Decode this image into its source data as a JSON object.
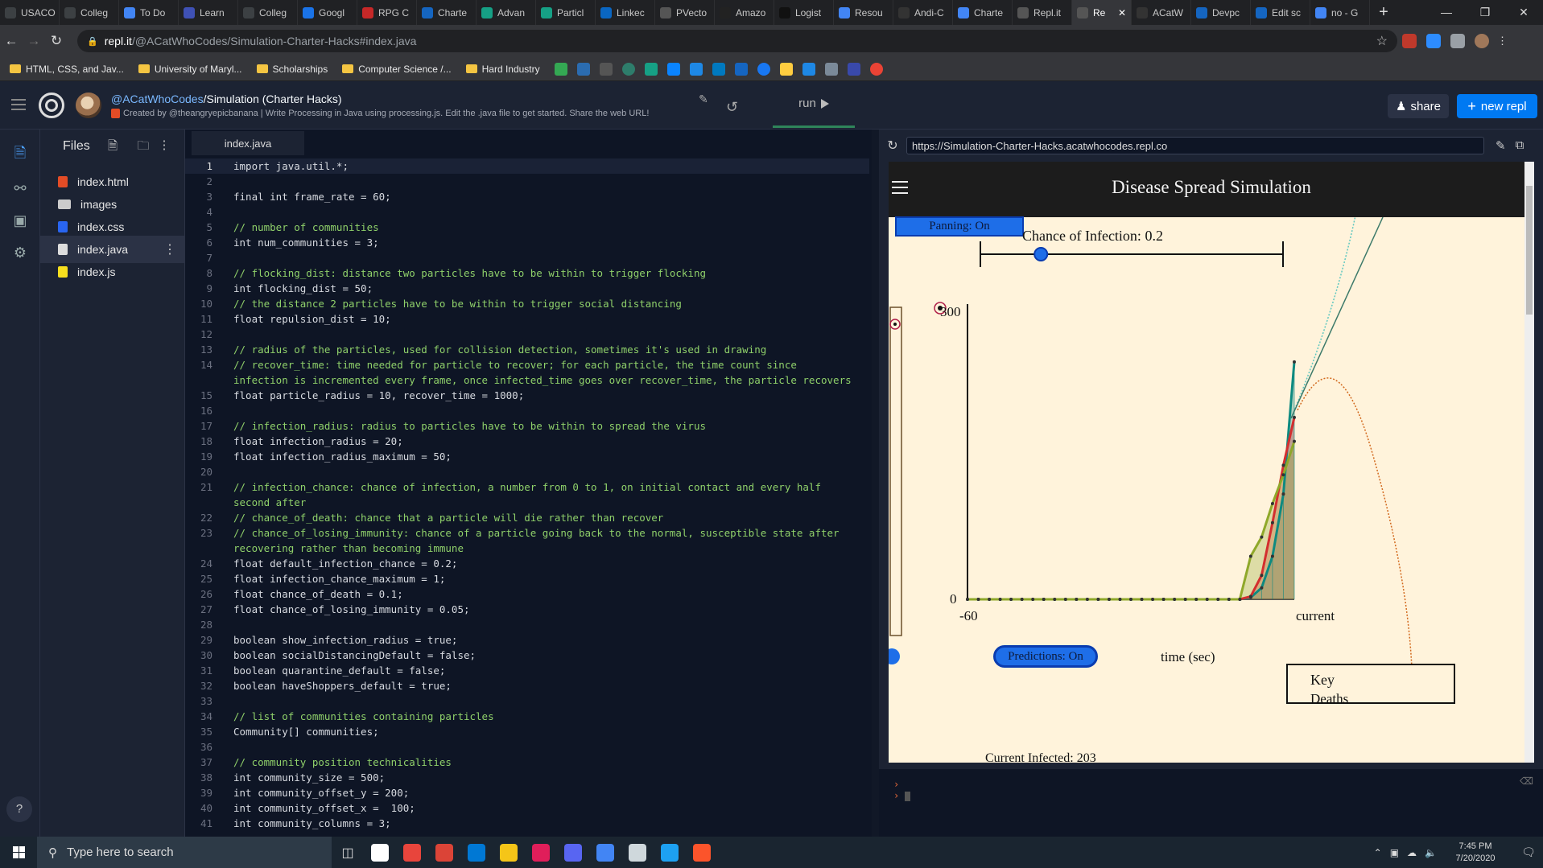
{
  "browser": {
    "tabs": [
      {
        "label": "USACO",
        "color": "#3c4043"
      },
      {
        "label": "Colleg",
        "color": "#3c4043"
      },
      {
        "label": "To Do",
        "color": "#4285f4"
      },
      {
        "label": "Learn",
        "color": "#3f51b5"
      },
      {
        "label": "Colleg",
        "color": "#3c4043"
      },
      {
        "label": "Googl",
        "color": "#1a73e8"
      },
      {
        "label": "RPG C",
        "color": "#c62828"
      },
      {
        "label": "Charte",
        "color": "#1565c0"
      },
      {
        "label": "Advan",
        "color": "#16a085"
      },
      {
        "label": "Particl",
        "color": "#16a085"
      },
      {
        "label": "Linkec",
        "color": "#0a66c2"
      },
      {
        "label": "PVecto",
        "color": "#555555"
      },
      {
        "label": "Amazo",
        "color": "#222222"
      },
      {
        "label": "Logist",
        "color": "#111111"
      },
      {
        "label": "Resou",
        "color": "#4285f4"
      },
      {
        "label": "Andi-C",
        "color": "#333333"
      },
      {
        "label": "Charte",
        "color": "#4285f4"
      },
      {
        "label": "Repl.it",
        "color": "#555555"
      },
      {
        "label": "Re",
        "color": "#555555",
        "active": true
      },
      {
        "label": "ACatW",
        "color": "#333333"
      },
      {
        "label": "Devpc",
        "color": "#1565c0"
      },
      {
        "label": "Edit sc",
        "color": "#1565c0"
      },
      {
        "label": "no - G",
        "color": "#4285f4"
      }
    ],
    "url_host": "repl.it",
    "url_path": "/@ACatWhoCodes/Simulation-Charter-Hacks#index.java",
    "bookmarks": [
      "HTML, CSS, and Jav...",
      "University of Maryl...",
      "Scholarships",
      "Computer Science /...",
      "Hard Industry"
    ]
  },
  "repl": {
    "owner": "@ACatWhoCodes",
    "title": "/Simulation (Charter Hacks)",
    "description": "Created by @theangryepicbanana | Write Processing in Java using processing.js. Edit the .java file to get started. Share the web URL!",
    "run_label": "run",
    "share_label": "share",
    "new_repl_label": "new repl"
  },
  "files": {
    "title": "Files",
    "items": [
      {
        "name": "index.html",
        "color": "#e34c26"
      },
      {
        "name": "images",
        "color": "#cccccc"
      },
      {
        "name": "index.css",
        "color": "#2965f1"
      },
      {
        "name": "index.java",
        "color": "#dddddd",
        "selected": true
      },
      {
        "name": "index.js",
        "color": "#f7df1e"
      }
    ]
  },
  "editor": {
    "tab_label": "index.java",
    "lines": [
      {
        "n": "1",
        "text": "import java.util.*;"
      },
      {
        "n": "2",
        "text": ""
      },
      {
        "n": "3",
        "text": "final int frame_rate = 60;"
      },
      {
        "n": "4",
        "text": ""
      },
      {
        "n": "5",
        "text": "// number of communities"
      },
      {
        "n": "6",
        "text": "int num_communities = 3;"
      },
      {
        "n": "7",
        "text": ""
      },
      {
        "n": "8",
        "text": "// flocking_dist: distance two particles have to be within to trigger flocking"
      },
      {
        "n": "9",
        "text": "int flocking_dist = 50;"
      },
      {
        "n": "10",
        "text": "// the distance 2 particles have to be within to trigger social distancing"
      },
      {
        "n": "11",
        "text": "float repulsion_dist = 10;"
      },
      {
        "n": "12",
        "text": ""
      },
      {
        "n": "13",
        "text": "// radius of the particles, used for collision detection, sometimes it's used in drawing"
      },
      {
        "n": "14",
        "text": "// recover_time: time needed for particle to recover; for each particle, the time count since infection is incremented every frame, once infected_time goes over recover_time, the particle recovers"
      },
      {
        "n": "15",
        "text": "float particle_radius = 10, recover_time = 1000;"
      },
      {
        "n": "16",
        "text": ""
      },
      {
        "n": "17",
        "text": "// infection_radius: radius to particles have to be within to spread the virus"
      },
      {
        "n": "18",
        "text": "float infection_radius = 20;"
      },
      {
        "n": "19",
        "text": "float infection_radius_maximum = 50;"
      },
      {
        "n": "20",
        "text": ""
      },
      {
        "n": "21",
        "text": "// infection_chance: chance of infection, a number from 0 to 1, on initial contact and every half second after"
      },
      {
        "n": "22",
        "text": "// chance_of_death: chance that a particle will die rather than recover"
      },
      {
        "n": "23",
        "text": "// chance_of_losing_immunity: chance of a particle going back to the normal, susceptible state after recovering rather than becoming immune"
      },
      {
        "n": "24",
        "text": "float default_infection_chance = 0.2;"
      },
      {
        "n": "25",
        "text": "float infection_chance_maximum = 1;"
      },
      {
        "n": "26",
        "text": "float chance_of_death = 0.1;"
      },
      {
        "n": "27",
        "text": "float chance_of_losing_immunity = 0.05;"
      },
      {
        "n": "28",
        "text": ""
      },
      {
        "n": "29",
        "text": "boolean show_infection_radius = true;"
      },
      {
        "n": "30",
        "text": "boolean socialDistancingDefault = false;"
      },
      {
        "n": "31",
        "text": "boolean quarantine_default = false;"
      },
      {
        "n": "32",
        "text": "boolean haveShoppers_default = true;"
      },
      {
        "n": "33",
        "text": ""
      },
      {
        "n": "34",
        "text": "// list of communities containing particles"
      },
      {
        "n": "35",
        "text": "Community[] communities;"
      },
      {
        "n": "36",
        "text": ""
      },
      {
        "n": "37",
        "text": "// community position technicalities"
      },
      {
        "n": "38",
        "text": "int community_size = 500;"
      },
      {
        "n": "39",
        "text": "int community_offset_y = 200;"
      },
      {
        "n": "40",
        "text": "int community_offset_x =  100;"
      },
      {
        "n": "41",
        "text": "int community_columns = 3;"
      }
    ]
  },
  "webview": {
    "url": "https://Simulation-Charter-Hacks.acatwhocodes.repl.co",
    "page_title": "Disease Spread Simulation",
    "panning_label": "Panning: On",
    "infection_label": "Chance of Infection: 0.2",
    "infection_slider_value": 0.2,
    "predictions_label": "Predictions: On",
    "time_axis_label": "time (sec)",
    "key_label": "Key",
    "key_first_entry": "Deaths",
    "current_infected_label": "Current Infected: 203",
    "chart_bg_color": "#fff3db"
  },
  "chart_data": {
    "type": "area",
    "title": "",
    "xlabel": "time (sec)",
    "ylabel": "",
    "x_tick_labels": [
      "-60",
      "current"
    ],
    "y_tick_labels": [
      "0",
      "300"
    ],
    "xlim": [
      -60,
      0
    ],
    "ylim": [
      0,
      300
    ],
    "x": [
      -60,
      -58,
      -56,
      -54,
      -52,
      -50,
      -48,
      -46,
      -44,
      -42,
      -40,
      -38,
      -36,
      -34,
      -32,
      -30,
      -28,
      -26,
      -24,
      -22,
      -20,
      -18,
      -16,
      -14,
      -12,
      -10,
      -8,
      -6,
      -4,
      -2,
      0
    ],
    "series": [
      {
        "color": "#0e8a80",
        "values": [
          0,
          0,
          0,
          0,
          0,
          0,
          0,
          0,
          0,
          0,
          0,
          0,
          0,
          0,
          0,
          0,
          0,
          0,
          0,
          0,
          0,
          0,
          0,
          0,
          0,
          0,
          2,
          12,
          45,
          110,
          248
        ]
      },
      {
        "color": "#d32f2f",
        "values": [
          0,
          0,
          0,
          0,
          0,
          0,
          0,
          0,
          0,
          0,
          0,
          0,
          0,
          0,
          0,
          0,
          0,
          0,
          0,
          0,
          0,
          0,
          0,
          0,
          0,
          0,
          3,
          25,
          80,
          140,
          190
        ]
      },
      {
        "color": "#8fa82a",
        "values": [
          0,
          0,
          0,
          0,
          0,
          0,
          0,
          0,
          0,
          0,
          0,
          0,
          0,
          0,
          0,
          0,
          0,
          0,
          0,
          0,
          0,
          0,
          0,
          0,
          0,
          0,
          45,
          65,
          100,
          130,
          165
        ]
      }
    ],
    "predictions": [
      {
        "style": "dotted",
        "color": "#5fc7c0",
        "trend": "rising"
      },
      {
        "style": "solid",
        "color": "#3d7a6a",
        "trend": "rising"
      },
      {
        "style": "dotted",
        "color": "#d2691e",
        "trend": "peak-then-fall"
      }
    ]
  },
  "taskbar": {
    "search_placeholder": "Type here to search",
    "time": "7:45 PM",
    "date": "7/20/2020",
    "apps": [
      "#ffffff",
      "#e8453c",
      "#db4437",
      "#0078d4",
      "#f5c518",
      "#e01e5a",
      "#5865f2",
      "#4285f4",
      "#cfd8dc",
      "#1da1f2",
      "#fb542b"
    ]
  }
}
